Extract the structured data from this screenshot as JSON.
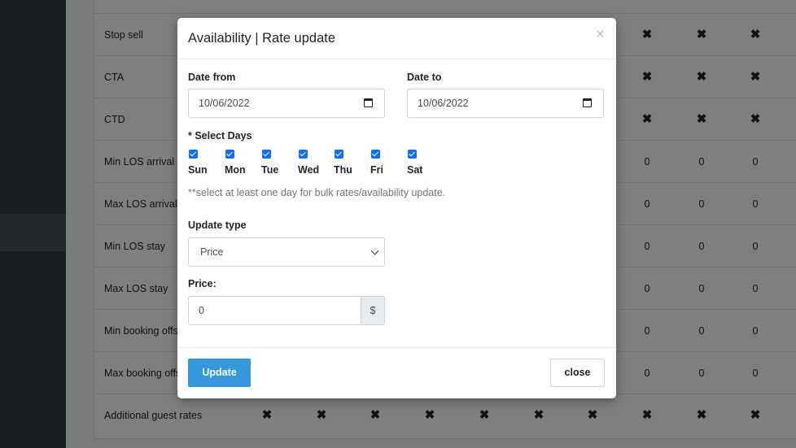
{
  "grid": {
    "rows": [
      {
        "label": "Stop sell",
        "cells": [
          "✖",
          "✖",
          "✖",
          "✖",
          "✖",
          "✖",
          "✖",
          "✖",
          "✖",
          "✖"
        ]
      },
      {
        "label": "CTA",
        "cells": [
          "✖",
          "✖",
          "✖",
          "✖",
          "✖",
          "✖",
          "✖",
          "✖",
          "✖",
          "✖"
        ]
      },
      {
        "label": "CTD",
        "cells": [
          "✖",
          "✖",
          "✖",
          "✖",
          "✖",
          "✖",
          "✖",
          "✖",
          "✖",
          "✖"
        ]
      },
      {
        "label": "Min LOS arrival",
        "cells": [
          "0",
          "0",
          "0",
          "0",
          "0",
          "0",
          "0",
          "0",
          "0",
          "0"
        ]
      },
      {
        "label": "Max LOS arrival",
        "cells": [
          "0",
          "0",
          "0",
          "0",
          "0",
          "0",
          "0",
          "0",
          "0",
          "0"
        ]
      },
      {
        "label": "Min LOS stay",
        "cells": [
          "0",
          "0",
          "0",
          "0",
          "0",
          "0",
          "0",
          "0",
          "0",
          "0"
        ]
      },
      {
        "label": "Max LOS stay",
        "cells": [
          "0",
          "0",
          "0",
          "0",
          "0",
          "0",
          "0",
          "0",
          "0",
          "0"
        ]
      },
      {
        "label": "Min booking offset",
        "cells": [
          "0",
          "0",
          "0",
          "0",
          "0",
          "0",
          "0",
          "0",
          "0",
          "0"
        ]
      },
      {
        "label": "Max booking offset",
        "cells": [
          "0",
          "0",
          "0",
          "0",
          "0",
          "0",
          "0",
          "0",
          "0",
          "0"
        ]
      },
      {
        "label": "Additional guest rates",
        "cells": [
          "✖",
          "✖",
          "✖",
          "✖",
          "✖",
          "✖",
          "✖",
          "✖",
          "✖",
          "✖"
        ]
      }
    ]
  },
  "modal": {
    "title": "Availability | Rate update",
    "close_glyph": "×",
    "date_from_label": "Date from",
    "date_from_value": "10/06/2022",
    "date_to_label": "Date to",
    "date_to_value": "10/06/2022",
    "select_days_label": "* Select Days",
    "days": [
      {
        "label": "Sun",
        "checked": true
      },
      {
        "label": "Mon",
        "checked": true
      },
      {
        "label": "Tue",
        "checked": true
      },
      {
        "label": "Wed",
        "checked": true
      },
      {
        "label": "Thu",
        "checked": true
      },
      {
        "label": "Fri",
        "checked": true
      },
      {
        "label": "Sat",
        "checked": true
      }
    ],
    "hint": "**select at least one day for bulk rates/availability update.",
    "update_type_label": "Update type",
    "update_type_value": "Price",
    "price_label": "Price:",
    "price_value": "0",
    "currency": "$",
    "update_button": "Update",
    "close_button": "close"
  },
  "colors": {
    "primary": "#3498db",
    "checkbox": "#0d6efd",
    "sidebar": "#343a40"
  }
}
